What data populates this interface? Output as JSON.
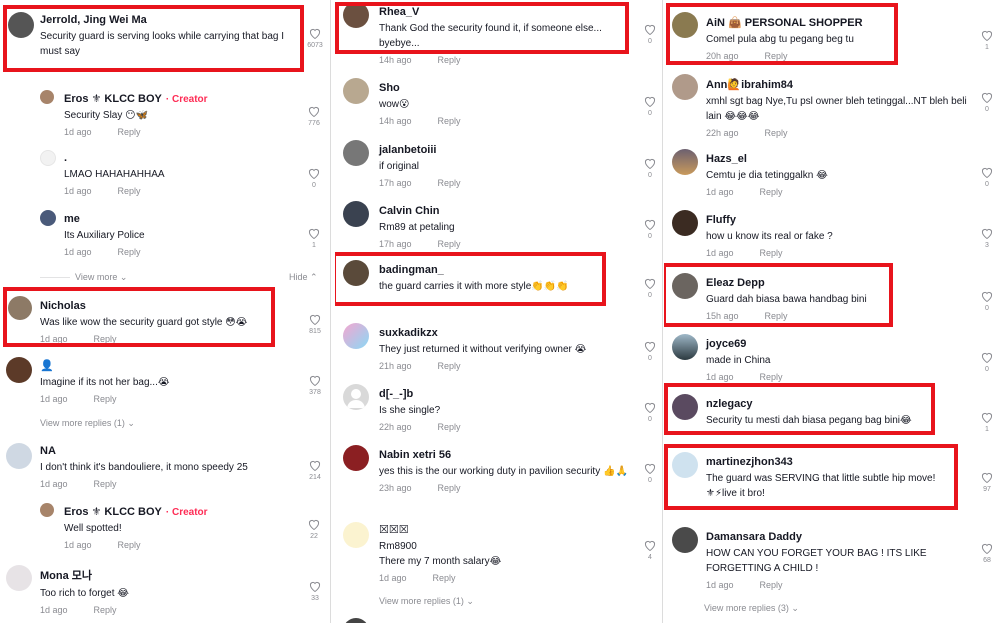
{
  "col1": {
    "comments": [
      {
        "name": "Jerrold, Jing Wei Ma",
        "text": "Security guard is serving looks while carrying that bag I must say",
        "time": "",
        "reply": "",
        "likes": "6073"
      },
      {
        "name": "Eros ⚜ KLCC BOY",
        "creator": "· Creator",
        "text": "Security Slay 😶🦋",
        "time": "1d ago",
        "reply": "Reply",
        "likes": "776"
      },
      {
        "name": ".",
        "text": "LMAO HAHAHAHHAA",
        "time": "1d ago",
        "reply": "Reply",
        "likes": "0"
      },
      {
        "name": "me",
        "text": "Its Auxiliary Police",
        "time": "1d ago",
        "reply": "Reply",
        "likes": "1"
      },
      {
        "name": "Nicholas",
        "text": "Was like wow the security guard got style 😳😭",
        "time": "1d ago",
        "reply": "Reply",
        "likes": "815"
      },
      {
        "name": "👤",
        "text": "Imagine if its not her bag...😭",
        "time": "1d ago",
        "reply": "Reply",
        "likes": "378"
      },
      {
        "name": "NA",
        "text": "I don't think it's bandouliere, it mono speedy 25",
        "time": "1d ago",
        "reply": "Reply",
        "likes": "214"
      },
      {
        "name": "Eros ⚜ KLCC BOY",
        "creator": "· Creator",
        "text": "Well spotted!",
        "time": "1d ago",
        "reply": "Reply",
        "likes": "22"
      },
      {
        "name": "Mona 모나",
        "text": "Too rich to forget 😂",
        "time": "1d ago",
        "reply": "Reply",
        "likes": "33"
      }
    ],
    "view_more_1": "View more ⌄",
    "hide": "Hide ⌃",
    "view_more_2": "View more replies (1) ⌄"
  },
  "col2": {
    "comments": [
      {
        "name": "Rhea_V",
        "text": "Thank God the security found it, if someone else... byebye...",
        "time": "14h ago",
        "reply": "Reply",
        "likes": "0"
      },
      {
        "name": "Sho",
        "text": "wow😮",
        "time": "14h ago",
        "reply": "Reply",
        "likes": "0"
      },
      {
        "name": "jalanbetoiii",
        "text": "if original",
        "time": "17h ago",
        "reply": "Reply",
        "likes": "0"
      },
      {
        "name": "Calvin Chin",
        "text": "Rm89 at petaling",
        "time": "17h ago",
        "reply": "Reply",
        "likes": "0"
      },
      {
        "name": "badingman_",
        "text": "the guard carries it with more style👏👏👏",
        "time": "",
        "reply": "",
        "likes": "0"
      },
      {
        "name": "suxkadikzx",
        "text": "They just returned it without verifying owner 😭",
        "time": "21h ago",
        "reply": "Reply",
        "likes": "0"
      },
      {
        "name": "d[-_-]b",
        "text": "Is she single?",
        "time": "22h ago",
        "reply": "Reply",
        "likes": "0"
      },
      {
        "name": "Nabin xetri 56",
        "text": "yes this is the our working duty in pavilion security 👍🙏",
        "time": "23h ago",
        "reply": "Reply",
        "likes": "0"
      },
      {
        "name": "☒☒☒",
        "text": "Rm8900\nThere my 7 month salary😂",
        "time": "1d ago",
        "reply": "Reply",
        "likes": "4"
      }
    ],
    "view_more": "View more replies (1) ⌄"
  },
  "col3": {
    "comments": [
      {
        "name": "AiN 👜 PERSONAL SHOPPER",
        "text": "Comel pula abg tu pegang beg tu",
        "time": "20h ago",
        "reply": "Reply",
        "likes": "1"
      },
      {
        "name": "Ann🙋ibrahim84",
        "text": "xmhl sgt bag Nye,Tu psl owner bleh tetinggal...NT bleh beli lain 😂😂😂",
        "time": "22h ago",
        "reply": "Reply",
        "likes": "0"
      },
      {
        "name": "Hazs_el",
        "text": "Cemtu je dia tetinggalkn 😂",
        "time": "1d ago",
        "reply": "Reply",
        "likes": "0"
      },
      {
        "name": "Fluffy",
        "text": "how u know its real or fake ?",
        "time": "1d ago",
        "reply": "Reply",
        "likes": "3"
      },
      {
        "name": "Eleaz Depp",
        "text": "Guard dah biasa bawa handbag bini",
        "time": "15h ago",
        "reply": "Reply",
        "likes": "0"
      },
      {
        "name": "joyce69",
        "text": "made in China",
        "time": "1d ago",
        "reply": "Reply",
        "likes": "0"
      },
      {
        "name": "nzlegacy",
        "text": "Security tu mesti dah biasa pegang bag bini😂",
        "time": "",
        "reply": "",
        "likes": "1"
      },
      {
        "name": "martinezjhon343",
        "text": "The guard was SERVING that little subtle hip move! ⚜⚡live it bro!",
        "time": "",
        "reply": "",
        "likes": "97"
      },
      {
        "name": "Damansara Daddy",
        "text": "HOW CAN YOU FORGET YOUR BAG ! ITS LIKE FORGETTING A CHILD !",
        "time": "1d ago",
        "reply": "Reply",
        "likes": "68"
      }
    ],
    "view_more": "View more replies (3) ⌄"
  },
  "colors": {
    "highlight": "#e8141c",
    "creator": "#fe2c55",
    "meta": "#8a8b91"
  }
}
